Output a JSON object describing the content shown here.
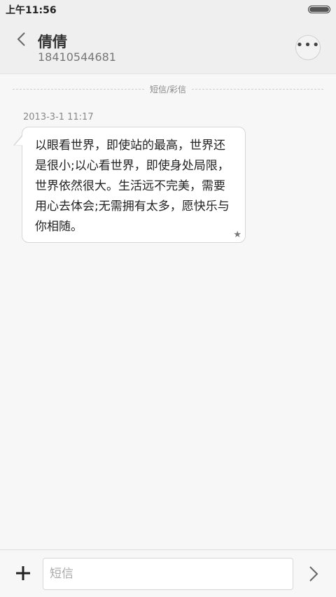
{
  "status_bar": {
    "time": "上午11:56",
    "battery_icon": "battery-icon"
  },
  "header": {
    "back_icon": "chevron-left-icon",
    "contact_name": "倩倩",
    "contact_number": "18410544681",
    "more_icon": "more-horizontal-icon"
  },
  "conversation": {
    "divider_label": "短信/彩信",
    "messages": [
      {
        "timestamp": "2013-3-1 11:17",
        "text": "以眼看世界，即使站的最高，世界还是很小;以心看世界，即使身处局限，世界依然很大。生活远不完美，需要用心去体会;无需拥有太多，愿快乐与你相随。",
        "starred_icon": "star-icon"
      }
    ]
  },
  "compose": {
    "add_icon": "plus-icon",
    "placeholder": "短信",
    "value": "",
    "send_icon": "chevron-right-icon"
  }
}
